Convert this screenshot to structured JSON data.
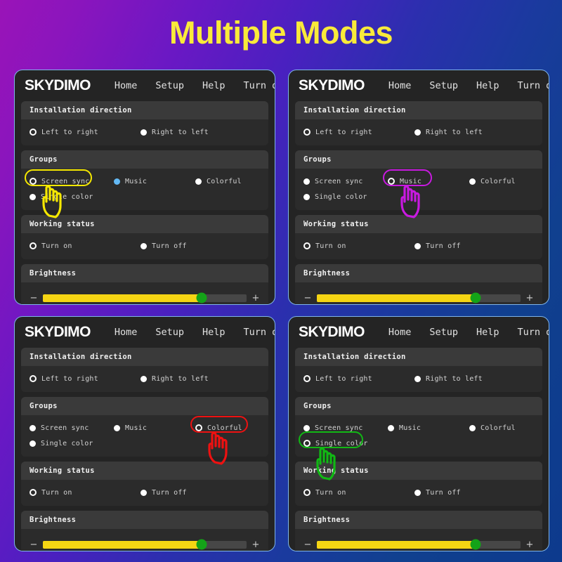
{
  "title": "Multiple Modes",
  "theme": {
    "title_color": "#f9ea3a",
    "panel_bg": "#242424",
    "panel_border": "#7fb4e8",
    "card_header_bg": "#3a3a3a",
    "slider_fill": "#f5d513",
    "slider_thumb": "#14a318",
    "bg_gradient_from": "#9a14b8",
    "bg_gradient_to": "#0d3a8d"
  },
  "nav": {
    "brand": "SKYDIMO",
    "links": [
      "Home",
      "Setup",
      "Help",
      "Turn off"
    ]
  },
  "sections": {
    "installation": "Installation direction",
    "groups": "Groups",
    "working_status": "Working status",
    "brightness": "Brightness"
  },
  "options": {
    "installation": [
      "Left to right",
      "Right to left"
    ],
    "groups": [
      "Screen sync",
      "Music",
      "Colorful",
      "Single color"
    ],
    "working_status": [
      "Turn on",
      "Turn off"
    ]
  },
  "slider": {
    "minus": "−",
    "plus": "+",
    "value_percent": 78
  },
  "panels": [
    {
      "id": "panel-screen-sync",
      "selected_group": "Screen sync",
      "hover_group": "Music",
      "highlight_color": "#f5e800",
      "selected_installation": "Left to right",
      "selected_working_status": "Turn on"
    },
    {
      "id": "panel-music",
      "selected_group": "Music",
      "hover_group": null,
      "highlight_color": "#c81ae0",
      "selected_installation": "Left to right",
      "selected_working_status": "Turn on"
    },
    {
      "id": "panel-colorful",
      "selected_group": "Colorful",
      "hover_group": null,
      "highlight_color": "#ee1111",
      "selected_installation": "Left to right",
      "selected_working_status": "Turn on"
    },
    {
      "id": "panel-single-color",
      "selected_group": "Single color",
      "hover_group": null,
      "highlight_color": "#11b814",
      "selected_installation": "Left to right",
      "selected_working_status": "Turn on"
    }
  ]
}
